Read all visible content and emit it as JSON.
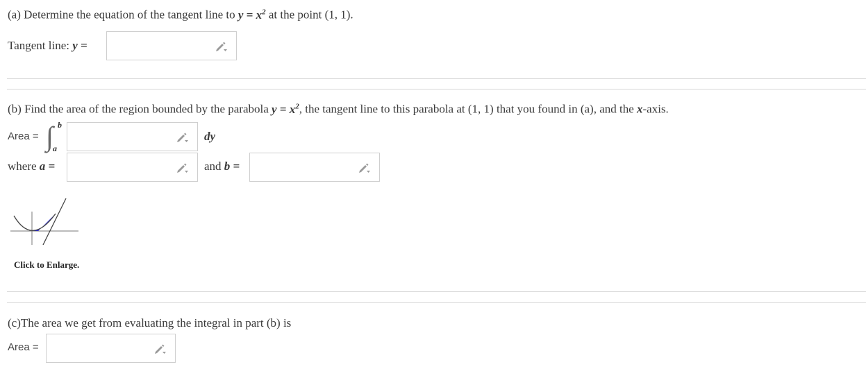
{
  "part_a": {
    "question_prefix": "(a) Determine the equation of the tangent line to",
    "question_eq": "y = x",
    "question_sup": "2",
    "question_suffix": "at the point (1, 1).",
    "tangent_label": "Tangent line:",
    "tangent_var": "y =",
    "tangent_value": ""
  },
  "part_b": {
    "question_prefix": "(b) Find the area of the region bounded by the parabola",
    "question_eq": "y = x",
    "question_sup": "2",
    "question_suffix": ", the tangent line to this parabola at (1, 1) that you found in (a), and the",
    "question_axis": "x",
    "question_end": "-axis.",
    "area_label": "Area =",
    "upper_limit": "b",
    "lower_limit": "a",
    "integrand_value": "",
    "differential": "dy",
    "where_label": "where",
    "a_var": "a =",
    "a_value": "",
    "and_label": "and",
    "b_var": "b =",
    "b_value": "",
    "enlarge_label": "Click to Enlarge."
  },
  "part_c": {
    "question": "(c)The area we get from evaluating the integral in part (b) is",
    "area_label": "Area =",
    "area_value": ""
  },
  "icons": {
    "pencil": "pencil-dropdown-icon",
    "thumbnail": "graph-thumbnail"
  },
  "colors": {
    "region_fill": "#2b2bd6",
    "border": "#cfcfcf"
  }
}
